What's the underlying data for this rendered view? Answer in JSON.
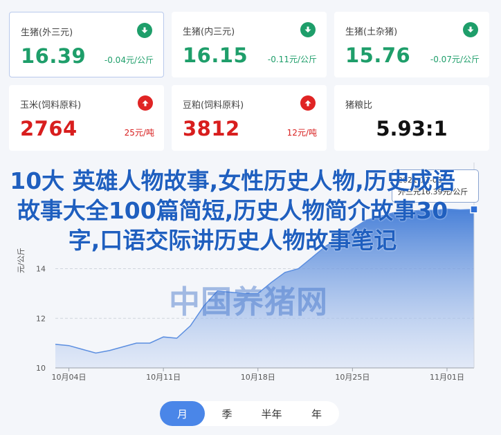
{
  "cards": [
    {
      "title": "生猪(外三元)",
      "price": "16.39",
      "change": "-0.04元/公斤",
      "trend": "down"
    },
    {
      "title": "生猪(内三元)",
      "price": "16.15",
      "change": "-0.11元/公斤",
      "trend": "down"
    },
    {
      "title": "生猪(土杂猪)",
      "price": "15.76",
      "change": "-0.07元/公斤",
      "trend": "down"
    },
    {
      "title": "玉米(饲料原料)",
      "price": "2764",
      "change": "25元/吨",
      "trend": "up"
    },
    {
      "title": "豆粕(饲料原料)",
      "price": "3812",
      "change": "12元/吨",
      "trend": "up"
    },
    {
      "title": "猪粮比",
      "price": "5.93:1"
    }
  ],
  "overlay_title": "10大  英雄人物故事,女性历史人物,历史成语故事大全100篇简短,历史人物简介故事30字,口语交际讲历史人物故事笔记",
  "watermark": "中国养猪网",
  "tooltip": {
    "date": "2021-11-03",
    "value_text": "外三元16.39元/公斤"
  },
  "periods": [
    "月",
    "季",
    "半年",
    "年"
  ],
  "active_period": "月",
  "colors": {
    "green": "#1e9e6a",
    "red": "#d81e1e",
    "accent": "#4a86e8",
    "line": "#5b8ee0"
  },
  "chart_data": {
    "type": "area",
    "ylabel": "元/公斤",
    "ylim": [
      10,
      18
    ],
    "yticks": [
      10,
      12,
      14
    ],
    "xlim": [
      "2021-10-03",
      "2021-11-03"
    ],
    "xticks": [
      {
        "date": "2021-10-04",
        "label": "10月04日"
      },
      {
        "date": "2021-10-11",
        "label": "10月11日"
      },
      {
        "date": "2021-10-18",
        "label": "10月18日"
      },
      {
        "date": "2021-10-25",
        "label": "10月25日"
      },
      {
        "date": "2021-11-01",
        "label": "11月01日"
      }
    ],
    "series": [
      {
        "name": "外三元",
        "x": [
          "2021-10-03",
          "2021-10-04",
          "2021-10-05",
          "2021-10-06",
          "2021-10-07",
          "2021-10-08",
          "2021-10-09",
          "2021-10-10",
          "2021-10-11",
          "2021-10-12",
          "2021-10-13",
          "2021-10-14",
          "2021-10-15",
          "2021-10-16",
          "2021-10-17",
          "2021-10-18",
          "2021-10-19",
          "2021-10-20",
          "2021-10-21",
          "2021-10-22",
          "2021-10-23",
          "2021-10-24",
          "2021-10-25",
          "2021-10-26",
          "2021-10-27",
          "2021-10-28",
          "2021-10-29",
          "2021-10-30",
          "2021-10-31",
          "2021-11-01",
          "2021-11-02",
          "2021-11-03"
        ],
        "values": [
          10.95,
          10.9,
          10.75,
          10.6,
          10.7,
          10.85,
          11.0,
          11.0,
          11.25,
          11.2,
          11.7,
          12.5,
          13.1,
          13.05,
          13.0,
          13.0,
          13.45,
          13.85,
          14.0,
          14.45,
          14.9,
          15.25,
          15.6,
          15.95,
          16.1,
          16.25,
          16.3,
          16.35,
          16.35,
          16.4,
          16.37,
          16.39
        ]
      }
    ]
  }
}
